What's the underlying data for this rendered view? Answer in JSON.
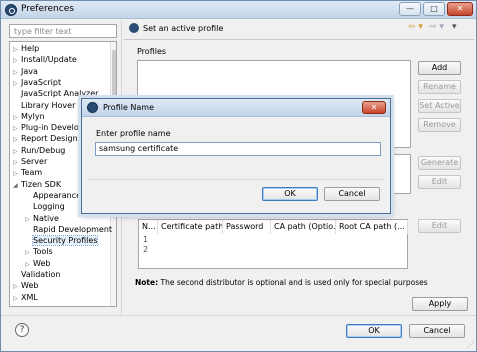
{
  "window": {
    "title": "Preferences",
    "minimize_label": "—",
    "maximize_label": "□",
    "close_label": "✕"
  },
  "filter": {
    "placeholder": "type filter text"
  },
  "tree": [
    {
      "label": "Help",
      "twisty": "▷",
      "indent": 0
    },
    {
      "label": "Install/Update",
      "twisty": "▷",
      "indent": 0
    },
    {
      "label": "Java",
      "twisty": "▷",
      "indent": 0
    },
    {
      "label": "JavaScript",
      "twisty": "▷",
      "indent": 0
    },
    {
      "label": "JavaScript Analyzer",
      "twisty": "",
      "indent": 0
    },
    {
      "label": "Library Hover",
      "twisty": "",
      "indent": 0
    },
    {
      "label": "Mylyn",
      "twisty": "▷",
      "indent": 0
    },
    {
      "label": "Plug-in Development",
      "twisty": "▷",
      "indent": 0
    },
    {
      "label": "Report Design",
      "twisty": "▷",
      "indent": 0
    },
    {
      "label": "Run/Debug",
      "twisty": "▷",
      "indent": 0
    },
    {
      "label": "Server",
      "twisty": "▷",
      "indent": 0
    },
    {
      "label": "Team",
      "twisty": "▷",
      "indent": 0
    },
    {
      "label": "Tizen SDK",
      "twisty": "◢",
      "indent": 0
    },
    {
      "label": "Appearance",
      "twisty": "",
      "indent": 1
    },
    {
      "label": "Logging",
      "twisty": "",
      "indent": 1
    },
    {
      "label": "Native",
      "twisty": "▷",
      "indent": 1
    },
    {
      "label": "Rapid Development",
      "twisty": "",
      "indent": 1
    },
    {
      "label": "Security Profiles",
      "twisty": "",
      "indent": 1
    },
    {
      "label": "Tools",
      "twisty": "▷",
      "indent": 1
    },
    {
      "label": "Web",
      "twisty": "▷",
      "indent": 1
    },
    {
      "label": "Validation",
      "twisty": "",
      "indent": 0
    },
    {
      "label": "Web",
      "twisty": "▷",
      "indent": 0
    },
    {
      "label": "XML",
      "twisty": "▷",
      "indent": 0
    }
  ],
  "page": {
    "title": "Set an active profile",
    "profiles_label": "Profiles",
    "buttons": {
      "add": "Add",
      "rename": "Rename",
      "set_active": "Set Active",
      "remove": "Remove",
      "generate": "Generate",
      "edit1": "Edit",
      "edit2": "Edit"
    },
    "table": {
      "columns": [
        "N...",
        "Certificate path",
        "Password",
        "CA path (Optio...",
        "Root CA path (..."
      ],
      "rows": [
        "1",
        "2"
      ]
    },
    "note_prefix": "Note:",
    "note_text": " The second distributor is optional and is used only for special purposes",
    "apply": "Apply"
  },
  "footer": {
    "ok": "OK",
    "cancel": "Cancel",
    "help_glyph": "?"
  },
  "dialog": {
    "title": "Profile Name",
    "close_label": "✕",
    "prompt": "Enter profile name",
    "value": "samsung certificate",
    "ok": "OK",
    "cancel": "Cancel"
  }
}
